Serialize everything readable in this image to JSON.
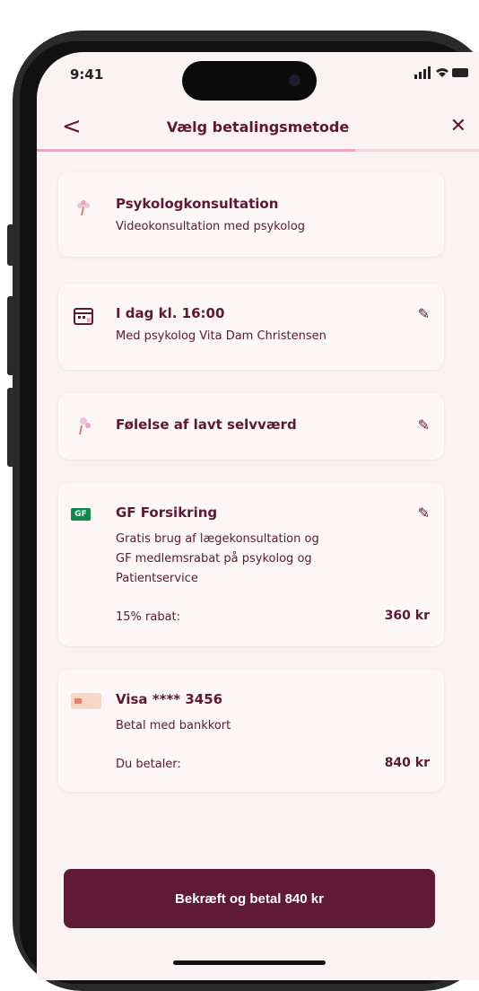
{
  "status_bar": {
    "time": "9:41",
    "icons": "signal-icon wifi-icon battery-icon"
  },
  "nav": {
    "back_label": "<",
    "title": "Vælg betalingsmetode",
    "close_label": "✕"
  },
  "progress": {
    "fraction": 0.72
  },
  "cards": [
    {
      "title": "Psykologkonsultation",
      "subtitle": "Videokonsultation med psykolog",
      "icon": "flower-icon"
    },
    {
      "title": "I dag kl. 16:00",
      "subtitle": "Med psykolog Vita Dam Christensen",
      "icon": "calendar-icon"
    },
    {
      "title": "Følelse af lavt selvværd",
      "icon": "thought-icon"
    },
    {
      "title": "GF Forsikring",
      "icon": "gf-badge-icon",
      "badge": "GF",
      "lines": [
        "Gratis brug af lægekonsultation og",
        "GF medlemsrabat på psykolog og",
        "Patientservice"
      ],
      "row_label": "15% rabat:",
      "row_value": "360 kr"
    },
    {
      "title": "Visa **** 3456",
      "subtitle": "Betal med bankkort",
      "icon": "card-icon",
      "row_label": "Du betaler:",
      "row_value": "840 kr"
    }
  ],
  "cta": {
    "label": "Bekræft og betal 840 kr"
  },
  "colors": {
    "accent": "#601a36",
    "background": "#fbf3f3",
    "progress": "#e8a5c6",
    "badge_green": "#0f8a4a"
  }
}
